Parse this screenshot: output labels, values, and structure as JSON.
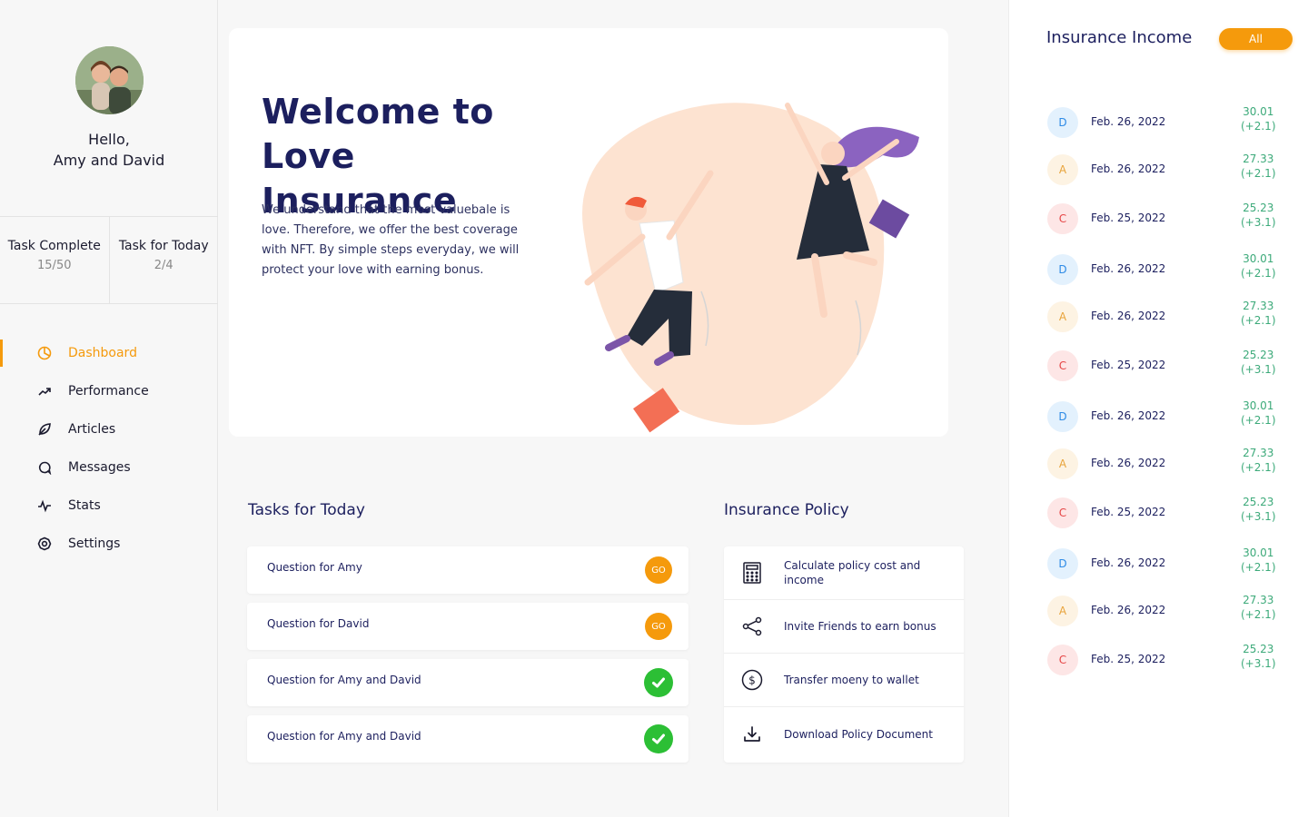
{
  "user": {
    "greeting": "Hello,",
    "names": "Amy and David"
  },
  "stats": [
    {
      "title": "Task Complete",
      "value": "15/50"
    },
    {
      "title": "Task for Today",
      "value": "2/4"
    }
  ],
  "nav": [
    {
      "label": "Dashboard",
      "icon": "pie-chart-icon",
      "active": true
    },
    {
      "label": "Performance",
      "icon": "trend-up-icon"
    },
    {
      "label": "Articles",
      "icon": "leaf-icon"
    },
    {
      "label": "Messages",
      "icon": "chat-bubble-icon"
    },
    {
      "label": "Stats",
      "icon": "pulse-icon"
    },
    {
      "label": "Settings",
      "icon": "gear-icon"
    }
  ],
  "hero": {
    "title_line1": "Welcome to",
    "title_line2": "Love Insurance",
    "text": "We understand that the most valuebale is love. Therefore, we offer the best coverage with NFT. By simple steps everyday, we will protect your love with earning bonus."
  },
  "tasks": {
    "title": "Tasks for Today",
    "go_label": "GO",
    "items": [
      {
        "label": "Question for Amy",
        "status": "go"
      },
      {
        "label": "Question for David",
        "status": "go"
      },
      {
        "label": "Question for Amy and David",
        "status": "done"
      },
      {
        "label": "Question for Amy and David",
        "status": "done"
      }
    ]
  },
  "policy": {
    "title": "Insurance Policy",
    "items": [
      {
        "label": "Calculate policy cost and income",
        "icon": "calculator-icon"
      },
      {
        "label": "Invite Friends to earn bonus",
        "icon": "share-icon"
      },
      {
        "label": "Transfer moeny to wallet",
        "icon": "dollar-circle-icon"
      },
      {
        "label": "Download Policy Document",
        "icon": "download-icon"
      }
    ]
  },
  "income": {
    "title": "Insurance Income",
    "filter_label": "All",
    "rows": [
      {
        "badge": "D",
        "date": "Feb. 26, 2022",
        "value": "30.01",
        "change": "(+2.1)"
      },
      {
        "badge": "A",
        "date": "Feb. 26, 2022",
        "value": "27.33",
        "change": "(+2.1)"
      },
      {
        "badge": "C",
        "date": "Feb. 25, 2022",
        "value": "25.23",
        "change": "(+3.1)"
      },
      {
        "badge": "D",
        "date": "Feb. 26, 2022",
        "value": "30.01",
        "change": "(+2.1)"
      },
      {
        "badge": "A",
        "date": "Feb. 26, 2022",
        "value": "27.33",
        "change": "(+2.1)"
      },
      {
        "badge": "C",
        "date": "Feb. 25, 2022",
        "value": "25.23",
        "change": "(+3.1)"
      },
      {
        "badge": "D",
        "date": "Feb. 26, 2022",
        "value": "30.01",
        "change": "(+2.1)"
      },
      {
        "badge": "A",
        "date": "Feb. 26, 2022",
        "value": "27.33",
        "change": "(+2.1)"
      },
      {
        "badge": "C",
        "date": "Feb. 25, 2022",
        "value": "25.23",
        "change": "(+3.1)"
      },
      {
        "badge": "D",
        "date": "Feb. 26, 2022",
        "value": "30.01",
        "change": "(+2.1)"
      },
      {
        "badge": "A",
        "date": "Feb. 26, 2022",
        "value": "27.33",
        "change": "(+2.1)"
      },
      {
        "badge": "C",
        "date": "Feb. 25, 2022",
        "value": "25.23",
        "change": "(+3.1)"
      }
    ]
  },
  "colors": {
    "accent": "#f59a0c",
    "navy": "#1c1f5e",
    "success": "#2cbf35",
    "income_value": "#3daa7a",
    "badge_D_bg": "#e3f1fd",
    "badge_D_fg": "#2e8be6",
    "badge_A_bg": "#fdf3e3",
    "badge_A_fg": "#e8a33a",
    "badge_C_bg": "#fde6e6",
    "badge_C_fg": "#e54545"
  }
}
